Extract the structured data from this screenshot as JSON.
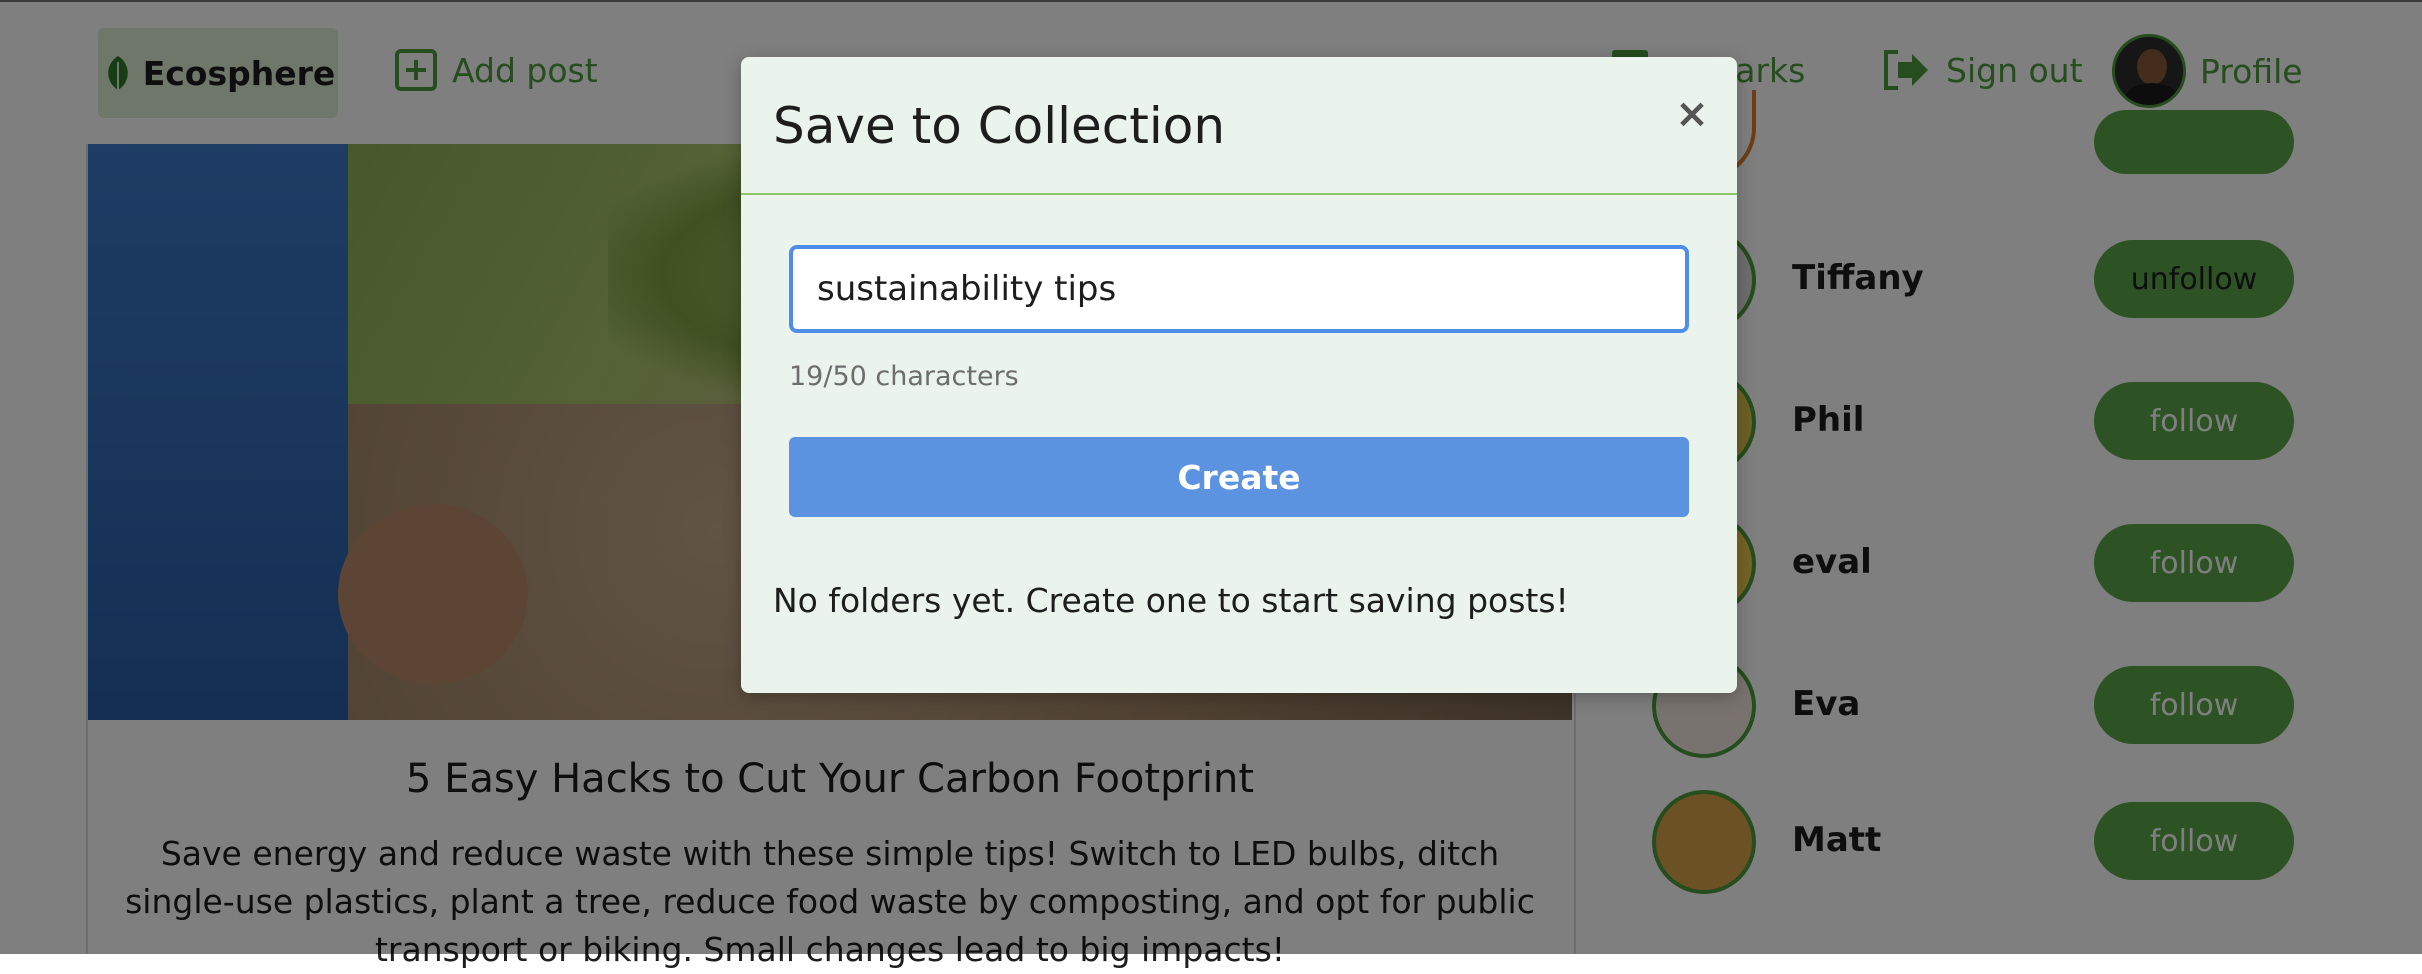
{
  "navbar": {
    "brand": "Ecosphere",
    "add_post": "Add post",
    "bookmarks_partial": "kmarks",
    "sign_out": "Sign out",
    "profile": "Profile"
  },
  "post": {
    "title": "5 Easy Hacks to Cut Your Carbon Footprint",
    "body": "Save energy and reduce waste with these simple tips! Switch to LED bulbs, ditch single-use plastics, plant a tree, reduce food waste by composting, and opt for public transport or biking. Small changes lead to big impacts!"
  },
  "sidebar": {
    "users": [
      {
        "name": "Tiffany",
        "action": "unfollow"
      },
      {
        "name": "Phil",
        "action": "follow"
      },
      {
        "name": "eval",
        "action": "follow"
      },
      {
        "name": "Eva",
        "action": "follow"
      },
      {
        "name": "Matt",
        "action": "follow"
      }
    ]
  },
  "modal": {
    "title": "Save to Collection",
    "close_glyph": "×",
    "input_value": "sustainability tips",
    "char_count": "19/50 characters",
    "create_label": "Create",
    "empty_message": "No folders yet. Create one to start saving posts!"
  },
  "colors": {
    "brand_green": "#4a9a3a",
    "follow_button": "#5aa548",
    "create_button": "#5c93e0",
    "modal_bg": "#eaf4ec",
    "input_focus_border": "#4f8ee8"
  },
  "icons": [
    "leaf-icon",
    "add-square-icon",
    "bookmark-icon",
    "sign-out-icon",
    "close-icon"
  ]
}
